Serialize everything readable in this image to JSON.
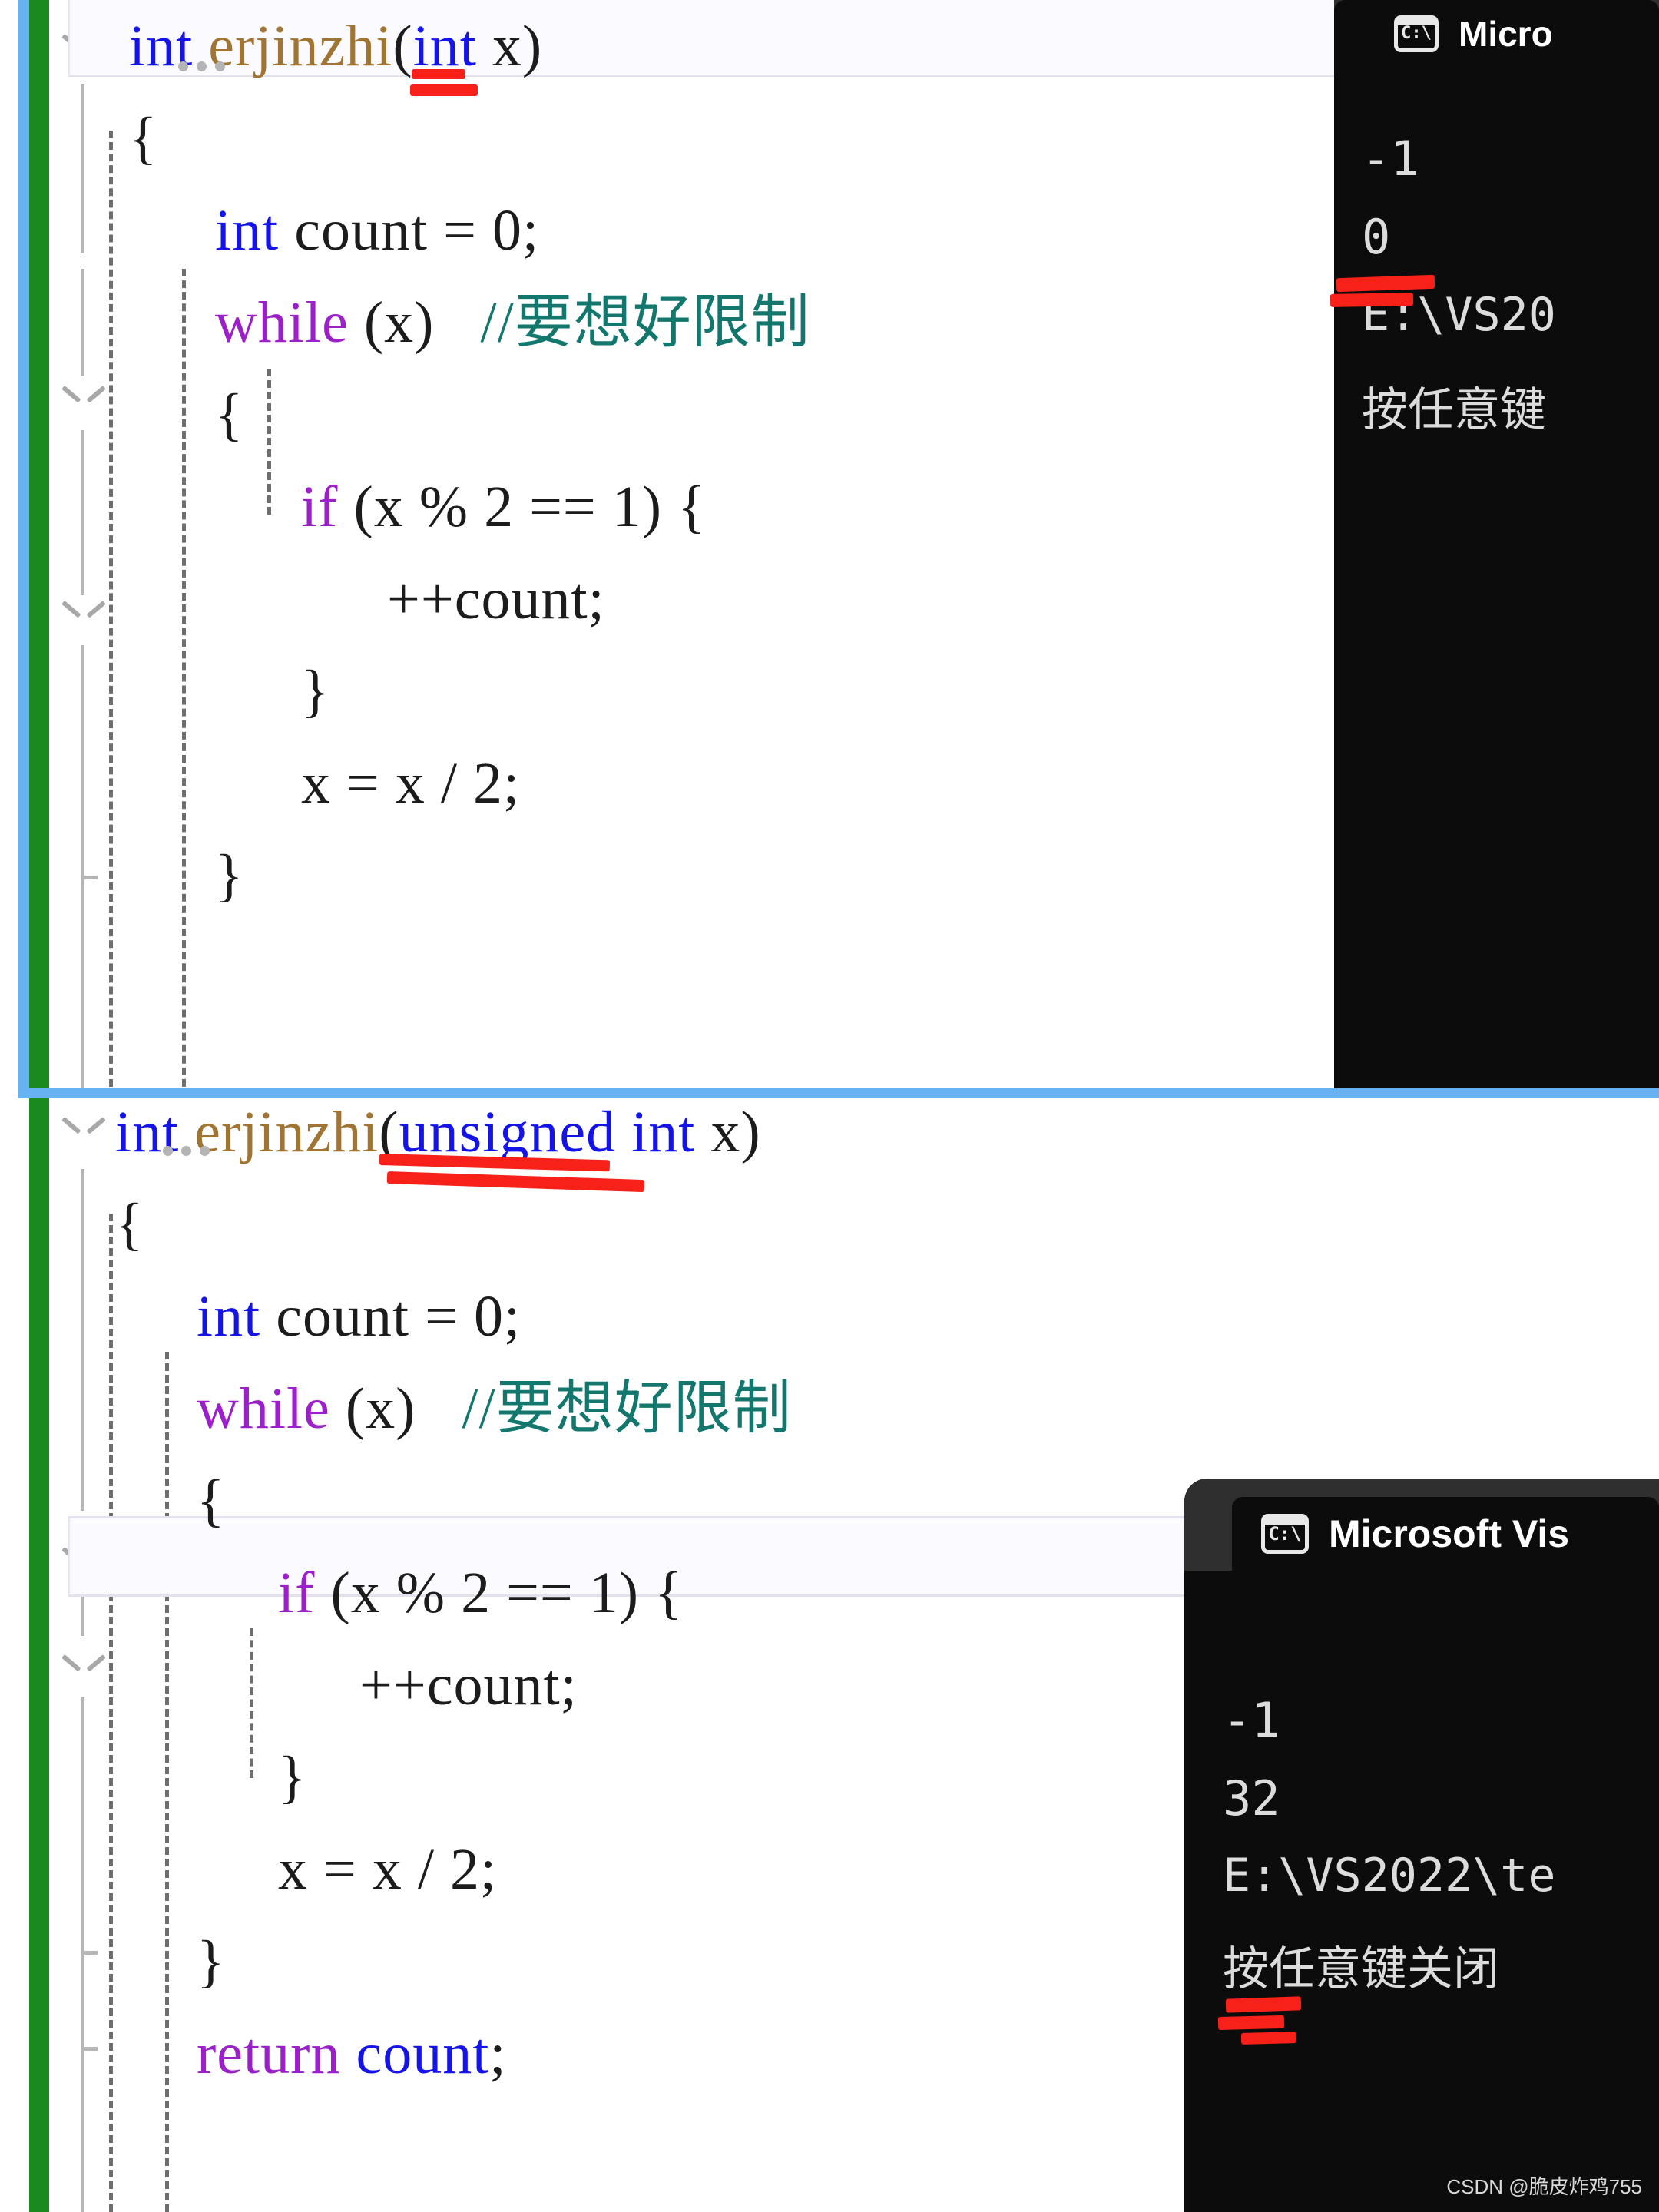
{
  "meta": {
    "watermark": "CSDN @脆皮炸鸡755"
  },
  "editor_top": {
    "name": "code-pane-signed",
    "highlighted_line_index": 0,
    "lines": [
      {
        "indent": 0,
        "tokens": [
          {
            "t": "int",
            "c": "kw"
          },
          {
            "t": " ",
            "c": "punc"
          },
          {
            "t": "erjinzhi",
            "c": "fn"
          },
          {
            "t": "(",
            "c": "punc"
          },
          {
            "t": "int",
            "c": "kw"
          },
          {
            "t": " x)",
            "c": "punc"
          }
        ]
      },
      {
        "indent": 0,
        "tokens": [
          {
            "t": "{",
            "c": "punc"
          }
        ]
      },
      {
        "indent": 1,
        "tokens": [
          {
            "t": "int",
            "c": "kw"
          },
          {
            "t": " count = ",
            "c": "punc"
          },
          {
            "t": "0",
            "c": "num"
          },
          {
            "t": ";",
            "c": "punc"
          }
        ]
      },
      {
        "indent": 1,
        "tokens": [
          {
            "t": "while",
            "c": "kw2"
          },
          {
            "t": " (x)   ",
            "c": "punc"
          },
          {
            "t": "//要想好限制",
            "c": "cmt"
          }
        ]
      },
      {
        "indent": 1,
        "tokens": [
          {
            "t": "{",
            "c": "punc"
          }
        ]
      },
      {
        "indent": 2,
        "tokens": [
          {
            "t": "if",
            "c": "kw2"
          },
          {
            "t": " (x % ",
            "c": "punc"
          },
          {
            "t": "2",
            "c": "num"
          },
          {
            "t": " == ",
            "c": "punc"
          },
          {
            "t": "1",
            "c": "num"
          },
          {
            "t": ") {",
            "c": "punc"
          }
        ]
      },
      {
        "indent": 3,
        "tokens": [
          {
            "t": "++count;",
            "c": "punc"
          }
        ]
      },
      {
        "indent": 2,
        "tokens": [
          {
            "t": "}",
            "c": "punc"
          }
        ]
      },
      {
        "indent": 2,
        "tokens": [
          {
            "t": "x = x / ",
            "c": "punc"
          },
          {
            "t": "2",
            "c": "num"
          },
          {
            "t": ";",
            "c": "punc"
          }
        ]
      },
      {
        "indent": 1,
        "tokens": [
          {
            "t": "}",
            "c": "punc"
          }
        ]
      }
    ]
  },
  "editor_bottom": {
    "name": "code-pane-unsigned",
    "highlighted_line_index": 3,
    "lines": [
      {
        "indent": 0,
        "tokens": [
          {
            "t": "int",
            "c": "kw"
          },
          {
            "t": " ",
            "c": "punc"
          },
          {
            "t": "erjinzhi",
            "c": "fn"
          },
          {
            "t": "(",
            "c": "punc"
          },
          {
            "t": "unsigned",
            "c": "kw"
          },
          {
            "t": " ",
            "c": "punc"
          },
          {
            "t": "int",
            "c": "kw"
          },
          {
            "t": " x)",
            "c": "punc"
          }
        ]
      },
      {
        "indent": 0,
        "tokens": [
          {
            "t": "{",
            "c": "punc"
          }
        ]
      },
      {
        "indent": 1,
        "tokens": [
          {
            "t": "int",
            "c": "kw"
          },
          {
            "t": " count = ",
            "c": "punc"
          },
          {
            "t": "0",
            "c": "num"
          },
          {
            "t": ";",
            "c": "punc"
          }
        ]
      },
      {
        "indent": 1,
        "tokens": [
          {
            "t": "while",
            "c": "kw2"
          },
          {
            "t": " (x)   ",
            "c": "punc"
          },
          {
            "t": "//要想好限制",
            "c": "cmt"
          }
        ]
      },
      {
        "indent": 1,
        "tokens": [
          {
            "t": "{",
            "c": "punc"
          }
        ]
      },
      {
        "indent": 2,
        "tokens": [
          {
            "t": "if",
            "c": "kw2"
          },
          {
            "t": " (x % ",
            "c": "punc"
          },
          {
            "t": "2",
            "c": "num"
          },
          {
            "t": " == ",
            "c": "punc"
          },
          {
            "t": "1",
            "c": "num"
          },
          {
            "t": ") {",
            "c": "punc"
          }
        ]
      },
      {
        "indent": 3,
        "tokens": [
          {
            "t": "++count;",
            "c": "punc"
          }
        ]
      },
      {
        "indent": 2,
        "tokens": [
          {
            "t": "}",
            "c": "punc"
          }
        ]
      },
      {
        "indent": 2,
        "tokens": [
          {
            "t": "x = x / ",
            "c": "punc"
          },
          {
            "t": "2",
            "c": "num"
          },
          {
            "t": ";",
            "c": "punc"
          }
        ]
      },
      {
        "indent": 1,
        "tokens": [
          {
            "t": "}",
            "c": "punc"
          }
        ]
      },
      {
        "indent": 1,
        "tokens": [
          {
            "t": "return",
            "c": "kw2"
          },
          {
            "t": " ",
            "c": "punc"
          },
          {
            "t": "count",
            "c": "kw"
          },
          {
            "t": ";",
            "c": "punc"
          }
        ]
      }
    ]
  },
  "console_top": {
    "name": "console-window-signed",
    "icon": "cmd-prompt-icon",
    "icon_label": "C:\\",
    "title": "Micro",
    "output": [
      "-1",
      "0",
      "E:\\VS20",
      "按任意键"
    ]
  },
  "console_bottom": {
    "name": "console-window-unsigned",
    "icon": "cmd-prompt-icon",
    "icon_label": "C:\\",
    "title": "Microsoft Vis",
    "output": [
      "-1",
      "32",
      "E:\\VS2022\\te",
      "按任意键关闭"
    ]
  },
  "annotations": {
    "top_underlines_label": "red-double-underline-int-x",
    "bottom_underlines_label": "red-double-underline-unsigned-int-x",
    "top_console_mark_label": "red-mark-output-0",
    "bottom_console_mark_label": "red-mark-output-32"
  },
  "colors": {
    "change_bar_green": "#1a8a1f",
    "selection_blue": "#66b2f2",
    "annotation_red": "#f72119",
    "console_bg": "#0c0c0c",
    "console_titlebar": "#2f2f2f",
    "keyword_blue": "#1414e8",
    "keyword_purple": "#9b20c9",
    "function_gold": "#a07433",
    "comment_teal": "#13776e"
  }
}
